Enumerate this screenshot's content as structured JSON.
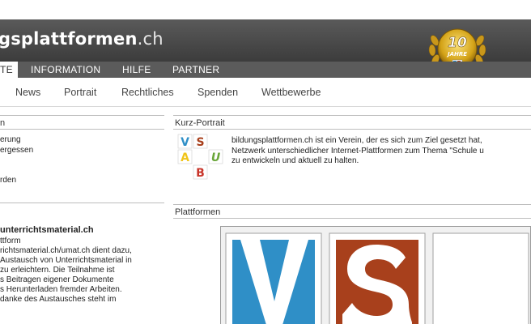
{
  "header": {
    "title_bold": "gsplattformen",
    "title_tld": ".ch",
    "badge_number": "10",
    "badge_text": "JAHRE"
  },
  "topnav": {
    "items": [
      {
        "label": "TE"
      },
      {
        "label": "INFORMATION"
      },
      {
        "label": "HILFE"
      },
      {
        "label": "PARTNER"
      }
    ]
  },
  "subnav": {
    "items": [
      {
        "label": "News"
      },
      {
        "label": "Portrait"
      },
      {
        "label": "Rechtliches"
      },
      {
        "label": "Spenden"
      },
      {
        "label": "Wettbewerbe"
      }
    ]
  },
  "left": {
    "section1_heading": "n",
    "section1_lines": [
      "erung",
      "ergessen",
      "",
      "",
      "rden"
    ],
    "section2_title": "unterrichtsmaterial.ch",
    "section2_lines": [
      "ttform",
      "richtsmaterial.ch/umat.ch dient dazu,",
      "Austausch von Unterrichtsmaterial in",
      " zu erleichtern. Die Teilnahme ist",
      "s Beitragen eigener Dokumente",
      "s Herunterladen fremder Arbeiten.",
      "danke des Austausches steht im"
    ]
  },
  "right": {
    "portrait_heading": "Kurz-Portrait",
    "portrait_lines": [
      "bildungsplattformen.ch ist ein Verein, der es sich zum Ziel gesetzt hat,",
      "Netzwerk unterschiedlicher Internet-Plattformen zum Thema \"Schule u",
      "zu entwickeln und aktuell zu halten."
    ],
    "logo_letters": [
      "V",
      "S",
      "A",
      "U",
      "B"
    ],
    "platforms_heading": "Plattformen"
  },
  "colors": {
    "header_bg": "#4a4a4a",
    "nav_bg": "#5b5b5b",
    "blue": "#2f8fc7",
    "rust": "#a8401c",
    "yellow": "#f0c419",
    "green": "#6aa63a",
    "red": "#c8352a",
    "gold": "#d4a317"
  }
}
